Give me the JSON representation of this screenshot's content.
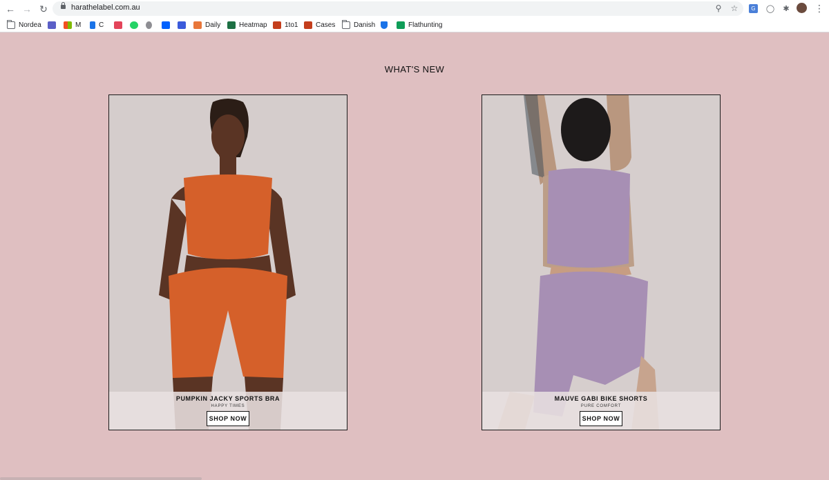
{
  "browser": {
    "url": "harathelabel.com.au",
    "bookmarks": [
      {
        "label": "Nordea",
        "icon": "folder-icon"
      },
      {
        "label": "",
        "icon": "teams-icon"
      },
      {
        "label": "M",
        "icon": "microsoft-icon"
      },
      {
        "label": "C",
        "icon": "calendar-icon"
      },
      {
        "label": "",
        "icon": "date-icon"
      },
      {
        "label": "",
        "icon": "whatsapp-icon"
      },
      {
        "label": "",
        "icon": "apple-icon"
      },
      {
        "label": "",
        "icon": "dropbox-icon"
      },
      {
        "label": "",
        "icon": "clock-icon"
      },
      {
        "label": "Daily",
        "icon": "doc-icon"
      },
      {
        "label": "Heatmap",
        "icon": "excel-icon"
      },
      {
        "label": "1to1",
        "icon": "powerpoint-icon"
      },
      {
        "label": "Cases",
        "icon": "powerpoint-icon"
      },
      {
        "label": "Danish",
        "icon": "folder-icon"
      },
      {
        "label": "",
        "icon": "shield-icon"
      },
      {
        "label": "Flathunting",
        "icon": "sheets-icon"
      }
    ]
  },
  "page": {
    "title": "WHAT'S NEW",
    "products": [
      {
        "title": "PUMPKIN JACKY SPORTS BRA",
        "subtitle": "HAPPY TIMES",
        "button": "SHOP NOW",
        "color": "#d5602a"
      },
      {
        "title": "MAUVE GABI BIKE SHORTS",
        "subtitle": "PURE COMFORT",
        "button": "SHOP NOW",
        "color": "#a78fb4"
      }
    ]
  },
  "colors": {
    "background": "#dfbfc1",
    "photo_bg": "#d7cfcf"
  }
}
